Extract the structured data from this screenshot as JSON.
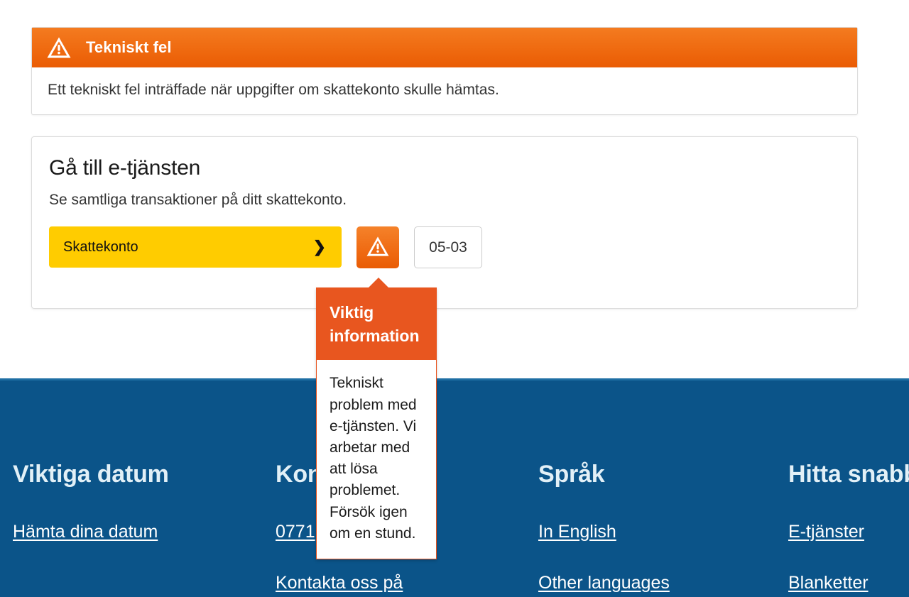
{
  "error_panel": {
    "icon": "warning-triangle-icon",
    "title": "Tekniskt fel",
    "message": "Ett tekniskt fel inträffade när uppgifter om skattekonto skulle hämtas.",
    "header_color": "#ef6a10"
  },
  "service_card": {
    "title": "Gå till e-tjänsten",
    "subtitle": "Se samtliga transaktioner på ditt skattekonto.",
    "primary_button": {
      "label": "Skattekonto",
      "chevron": "chevron-right-icon",
      "color": "#ffcc00"
    },
    "warning_button": {
      "icon": "warning-triangle-icon",
      "color": "#ef6a12"
    },
    "date_badge": "05-03"
  },
  "tooltip": {
    "title": "Viktig information",
    "body": "Tekniskt problem med e-tjänsten. Vi arbetar med att lösa problemet. Försök igen om en stund.",
    "accent_color": "#e8561f"
  },
  "footer": {
    "background": "#0b5489",
    "columns": [
      {
        "heading": "Viktiga datum",
        "links": [
          "Hämta dina datum"
        ]
      },
      {
        "heading": "Kontakt",
        "links": [
          "0771",
          "Kontakta oss på"
        ]
      },
      {
        "heading": "Språk",
        "links": [
          "In English",
          "Other languages"
        ]
      },
      {
        "heading": "Hitta snabbt",
        "links": [
          "E-tjänster",
          "Blanketter"
        ]
      }
    ]
  }
}
